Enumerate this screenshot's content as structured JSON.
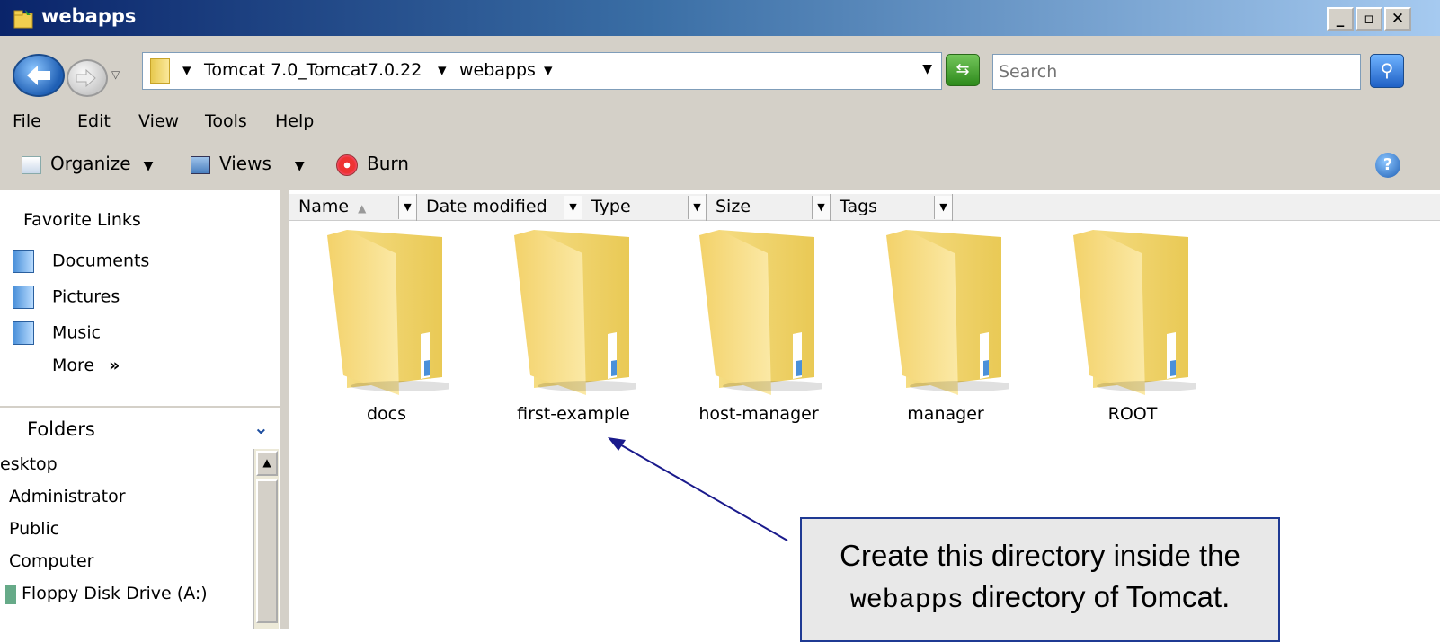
{
  "window": {
    "title": "webapps",
    "minimize": "_",
    "restore": "▫",
    "close": "✕"
  },
  "address": {
    "crumbs": [
      "Tomcat 7.0_Tomcat7.0.22",
      "webapps"
    ],
    "search_placeholder": "Search"
  },
  "menu": [
    "File",
    "Edit",
    "View",
    "Tools",
    "Help"
  ],
  "toolbar": {
    "organize": "Organize",
    "views": "Views",
    "burn": "Burn"
  },
  "favorites": {
    "title": "Favorite Links",
    "items": [
      "Documents",
      "Pictures",
      "Music"
    ],
    "more": "More"
  },
  "folders_pane": {
    "title": "Folders",
    "items": [
      "esktop",
      "Administrator",
      "Public",
      "Computer",
      "Floppy Disk Drive (A:)"
    ]
  },
  "columns": [
    "Name",
    "Date modified",
    "Type",
    "Size",
    "Tags"
  ],
  "folders": [
    "docs",
    "first-example",
    "host-manager",
    "manager",
    "ROOT"
  ],
  "callout": {
    "line1": "Create this directory inside the",
    "mono": "webapps",
    "line2_rest": " directory of Tomcat."
  },
  "colors": {
    "title_start": "#0a246a",
    "title_end": "#a6caf0",
    "callout_border": "#1f3a93",
    "arrow": "#1a1a8c"
  }
}
